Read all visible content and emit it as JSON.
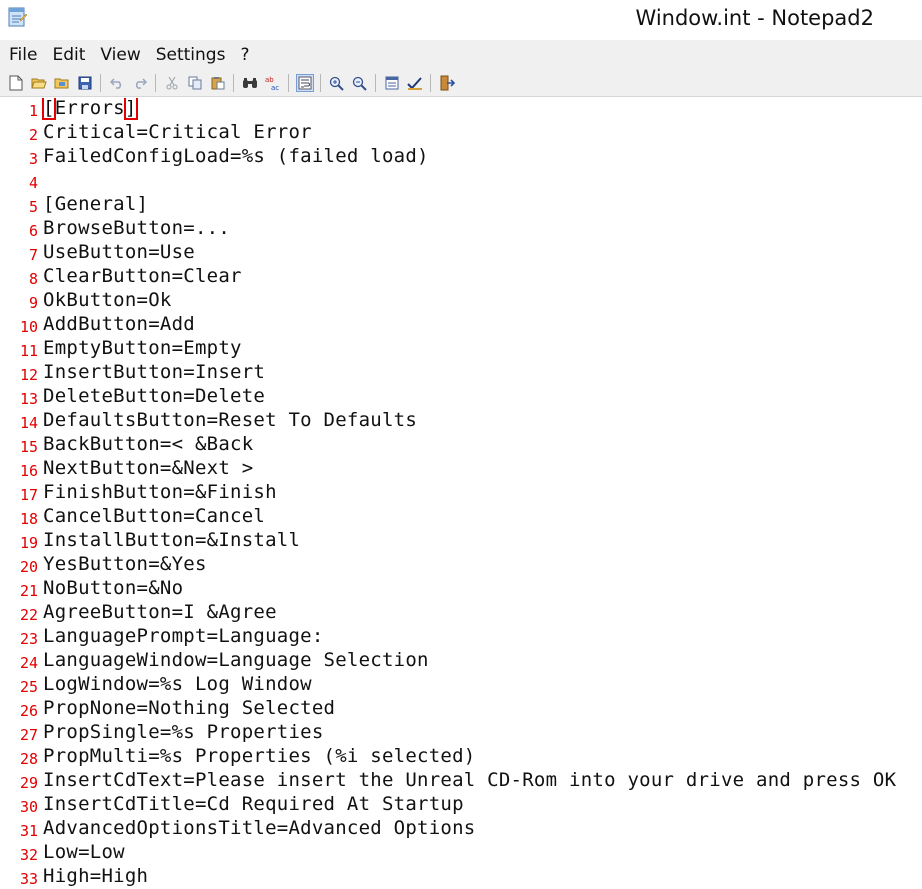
{
  "window": {
    "title": "Window.int - Notepad2"
  },
  "menu": [
    "File",
    "Edit",
    "View",
    "Settings",
    "?"
  ],
  "toolbar": {
    "groups": [
      [
        "new-file-icon",
        "open-folder-icon",
        "browse-folder-icon",
        "save-icon"
      ],
      [
        "undo-icon",
        "redo-icon"
      ],
      [
        "cut-icon",
        "copy-icon",
        "paste-icon"
      ],
      [
        "find-icon",
        "replace-icon"
      ],
      [
        "word-wrap-icon"
      ],
      [
        "zoom-in-icon",
        "zoom-out-icon"
      ],
      [
        "view-list-icon",
        "edit-check-icon"
      ],
      [
        "exit-icon"
      ]
    ],
    "active": "word-wrap-icon"
  },
  "editor": {
    "lines": [
      "[Errors]",
      "Critical=Critical Error",
      "FailedConfigLoad=%s (failed load)",
      "",
      "[General]",
      "BrowseButton=...",
      "UseButton=Use",
      "ClearButton=Clear",
      "OkButton=Ok",
      "AddButton=Add",
      "EmptyButton=Empty",
      "InsertButton=Insert",
      "DeleteButton=Delete",
      "DefaultsButton=Reset To Defaults",
      "BackButton=< &Back",
      "NextButton=&Next >",
      "FinishButton=&Finish",
      "CancelButton=Cancel",
      "InstallButton=&Install",
      "YesButton=&Yes",
      "NoButton=&No",
      "AgreeButton=I &Agree",
      "LanguagePrompt=Language:",
      "LanguageWindow=Language Selection",
      "LogWindow=%s Log Window",
      "PropNone=Nothing Selected",
      "PropSingle=%s Properties",
      "PropMulti=%s Properties (%i selected)",
      "InsertCdText=Please insert the Unreal CD-Rom into your drive and press OK",
      "InsertCdTitle=Cd Required At Startup",
      "AdvancedOptionsTitle=Advanced Options",
      "Low=Low",
      "High=High"
    ],
    "line_number_color": "#e00000",
    "bracket_highlight_color": "#e00000"
  }
}
